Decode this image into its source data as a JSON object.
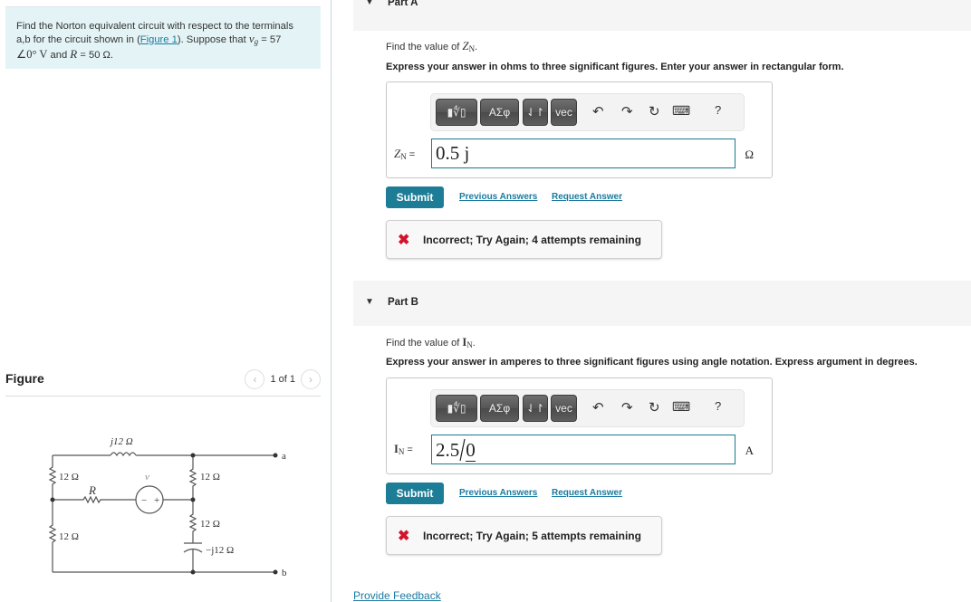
{
  "problem": {
    "text_pre": "Find the Norton equivalent circuit with respect to the terminals a,b for the circuit shown in (",
    "figure_link": "Figure 1",
    "text_mid": "). Suppose that ",
    "vg_symbol": "v",
    "vg_sub": "g",
    "vg_value": " = 57",
    "angle_line": "∠0° V",
    "and_text": " and ",
    "r_symbol": "R",
    "r_value": " = 50 Ω."
  },
  "figure": {
    "title": "Figure",
    "pager_text": "1 of 1",
    "prev_icon": "‹",
    "next_icon": "›",
    "circuit": {
      "inductor_label": "j12 Ω",
      "left_top_resistor": "12 Ω",
      "left_bottom_resistor": "12 Ω",
      "r_label": "R",
      "source_label": "v",
      "source_sub": "g",
      "source_minus": "−",
      "source_plus": "+",
      "right_top_resistor": "12 Ω",
      "right_bottom_resistor": "12 Ω",
      "capacitor_label": "−j12 Ω",
      "terminal_a": "a",
      "terminal_b": "b"
    }
  },
  "toolbar": {
    "templates_label": "▮∜▯",
    "greek_label": "ΑΣφ",
    "arrows_label": "⇃↾",
    "vec_label": "vec",
    "undo_icon": "↶",
    "redo_icon": "↷",
    "reset_icon": "↻",
    "keyboard_icon": "⌨",
    "help_label": "?"
  },
  "partA": {
    "label": "Part A",
    "question_pre": "Find the value of ",
    "question_var": "Z",
    "question_sub": "N",
    "question_post": ".",
    "instructions": "Express your answer in ohms to three significant figures. Enter your answer in rectangular form.",
    "input_label": "Z",
    "input_sub": "N",
    "input_eq": " =",
    "input_value": "0.5 j",
    "unit": "Ω",
    "submit_label": "Submit",
    "previous_answers": "Previous Answers",
    "request_answer": "Request Answer",
    "feedback_icon": "✖",
    "feedback_text": "Incorrect; Try Again; 4 attempts remaining"
  },
  "partB": {
    "label": "Part B",
    "question_pre": "Find the value of ",
    "question_var": "I",
    "question_sub": "N",
    "question_post": ".",
    "instructions": "Express your answer in amperes to three significant figures using angle notation. Express argument in degrees.",
    "input_label": "I",
    "input_sub": "N",
    "input_eq": " =",
    "input_magnitude": "2.5",
    "input_angle": "0",
    "unit": "A",
    "submit_label": "Submit",
    "previous_answers": "Previous Answers",
    "request_answer": "Request Answer",
    "feedback_icon": "✖",
    "feedback_text": "Incorrect; Try Again; 5 attempts remaining"
  },
  "footer": {
    "provide_feedback": "Provide Feedback"
  }
}
